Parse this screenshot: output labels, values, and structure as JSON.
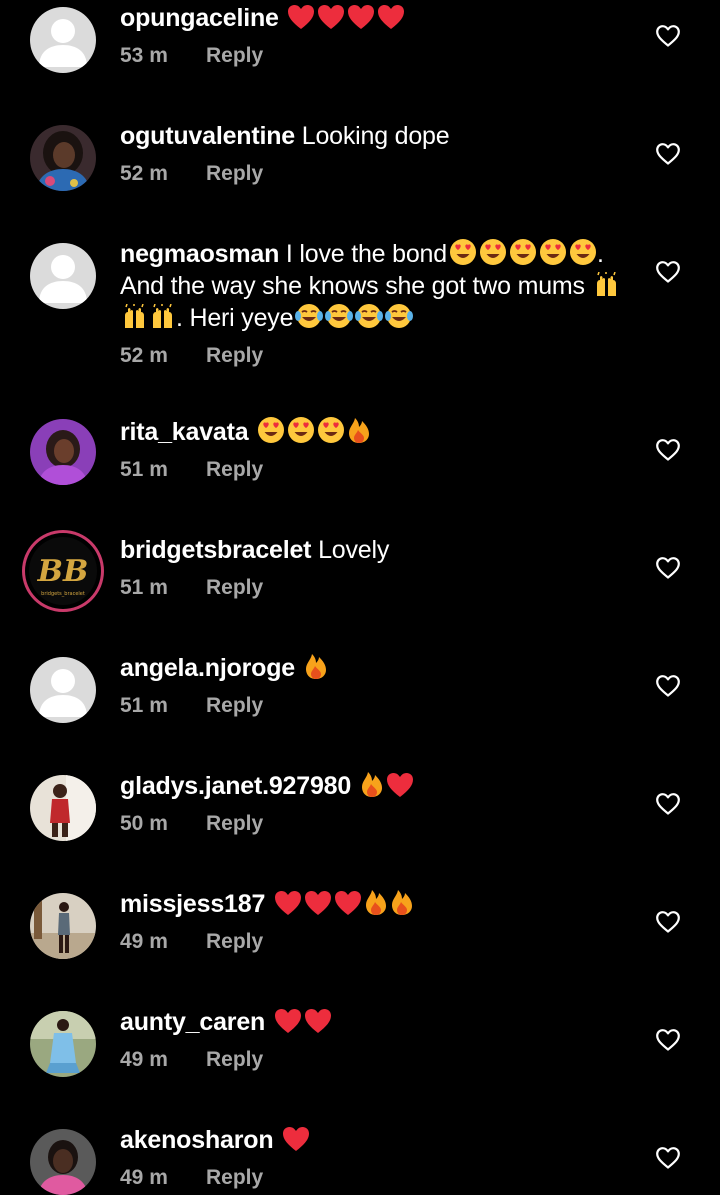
{
  "comments": [
    {
      "username": "opungaceline",
      "text": "",
      "emojis": [
        "heart",
        "heart",
        "heart",
        "heart"
      ],
      "time": "53 m",
      "reply_label": "Reply",
      "avatar": "default-avatar"
    },
    {
      "username": "ogutuvalentine",
      "text": "Looking dope",
      "emojis": [],
      "time": "52 m",
      "reply_label": "Reply",
      "avatar": "photo-avatar"
    },
    {
      "username": "negmaosman",
      "text_part1": "I love the bond",
      "text_part2": ". And the way she knows she got two mums",
      "text_part3": ". Heri yeye",
      "time": "52 m",
      "reply_label": "Reply",
      "avatar": "default-avatar"
    },
    {
      "username": "rita_kavata",
      "text": "",
      "emojis": [
        "heart-eyes",
        "heart-eyes",
        "heart-eyes",
        "fire"
      ],
      "time": "51 m",
      "reply_label": "Reply",
      "avatar": "photo-avatar"
    },
    {
      "username": "bridgetsbracelet",
      "text": "Lovely",
      "emojis": [],
      "time": "51 m",
      "reply_label": "Reply",
      "avatar": "brand-logo-avatar",
      "avatar_letters": "BB",
      "avatar_caption": "bridgets_bracelet"
    },
    {
      "username": "angela.njoroge",
      "text": "",
      "emojis": [
        "fire"
      ],
      "time": "51 m",
      "reply_label": "Reply",
      "avatar": "default-avatar"
    },
    {
      "username": "gladys.janet.927980",
      "text": "",
      "emojis": [
        "fire",
        "heart"
      ],
      "time": "50 m",
      "reply_label": "Reply",
      "avatar": "photo-avatar"
    },
    {
      "username": "missjess187",
      "text": "",
      "emojis": [
        "heart",
        "heart",
        "heart",
        "fire",
        "fire"
      ],
      "time": "49 m",
      "reply_label": "Reply",
      "avatar": "photo-avatar"
    },
    {
      "username": "aunty_caren",
      "text": "",
      "emojis": [
        "heart",
        "heart"
      ],
      "time": "49 m",
      "reply_label": "Reply",
      "avatar": "photo-avatar"
    },
    {
      "username": "akenosharon",
      "text": "",
      "emojis": [
        "heart"
      ],
      "time": "49 m",
      "reply_label": "Reply",
      "avatar": "photo-avatar"
    }
  ],
  "colors": {
    "background": "#000000",
    "text": "#ffffff",
    "meta": "#a8a8a8",
    "heart": "#ed2d3d",
    "emoji_face": "#ffc83d",
    "fire": "#f7a21b",
    "default_avatar": "#dbdbdb"
  },
  "icons": {
    "like": "heart-outline-icon",
    "default_avatar": "person-silhouette-icon"
  }
}
